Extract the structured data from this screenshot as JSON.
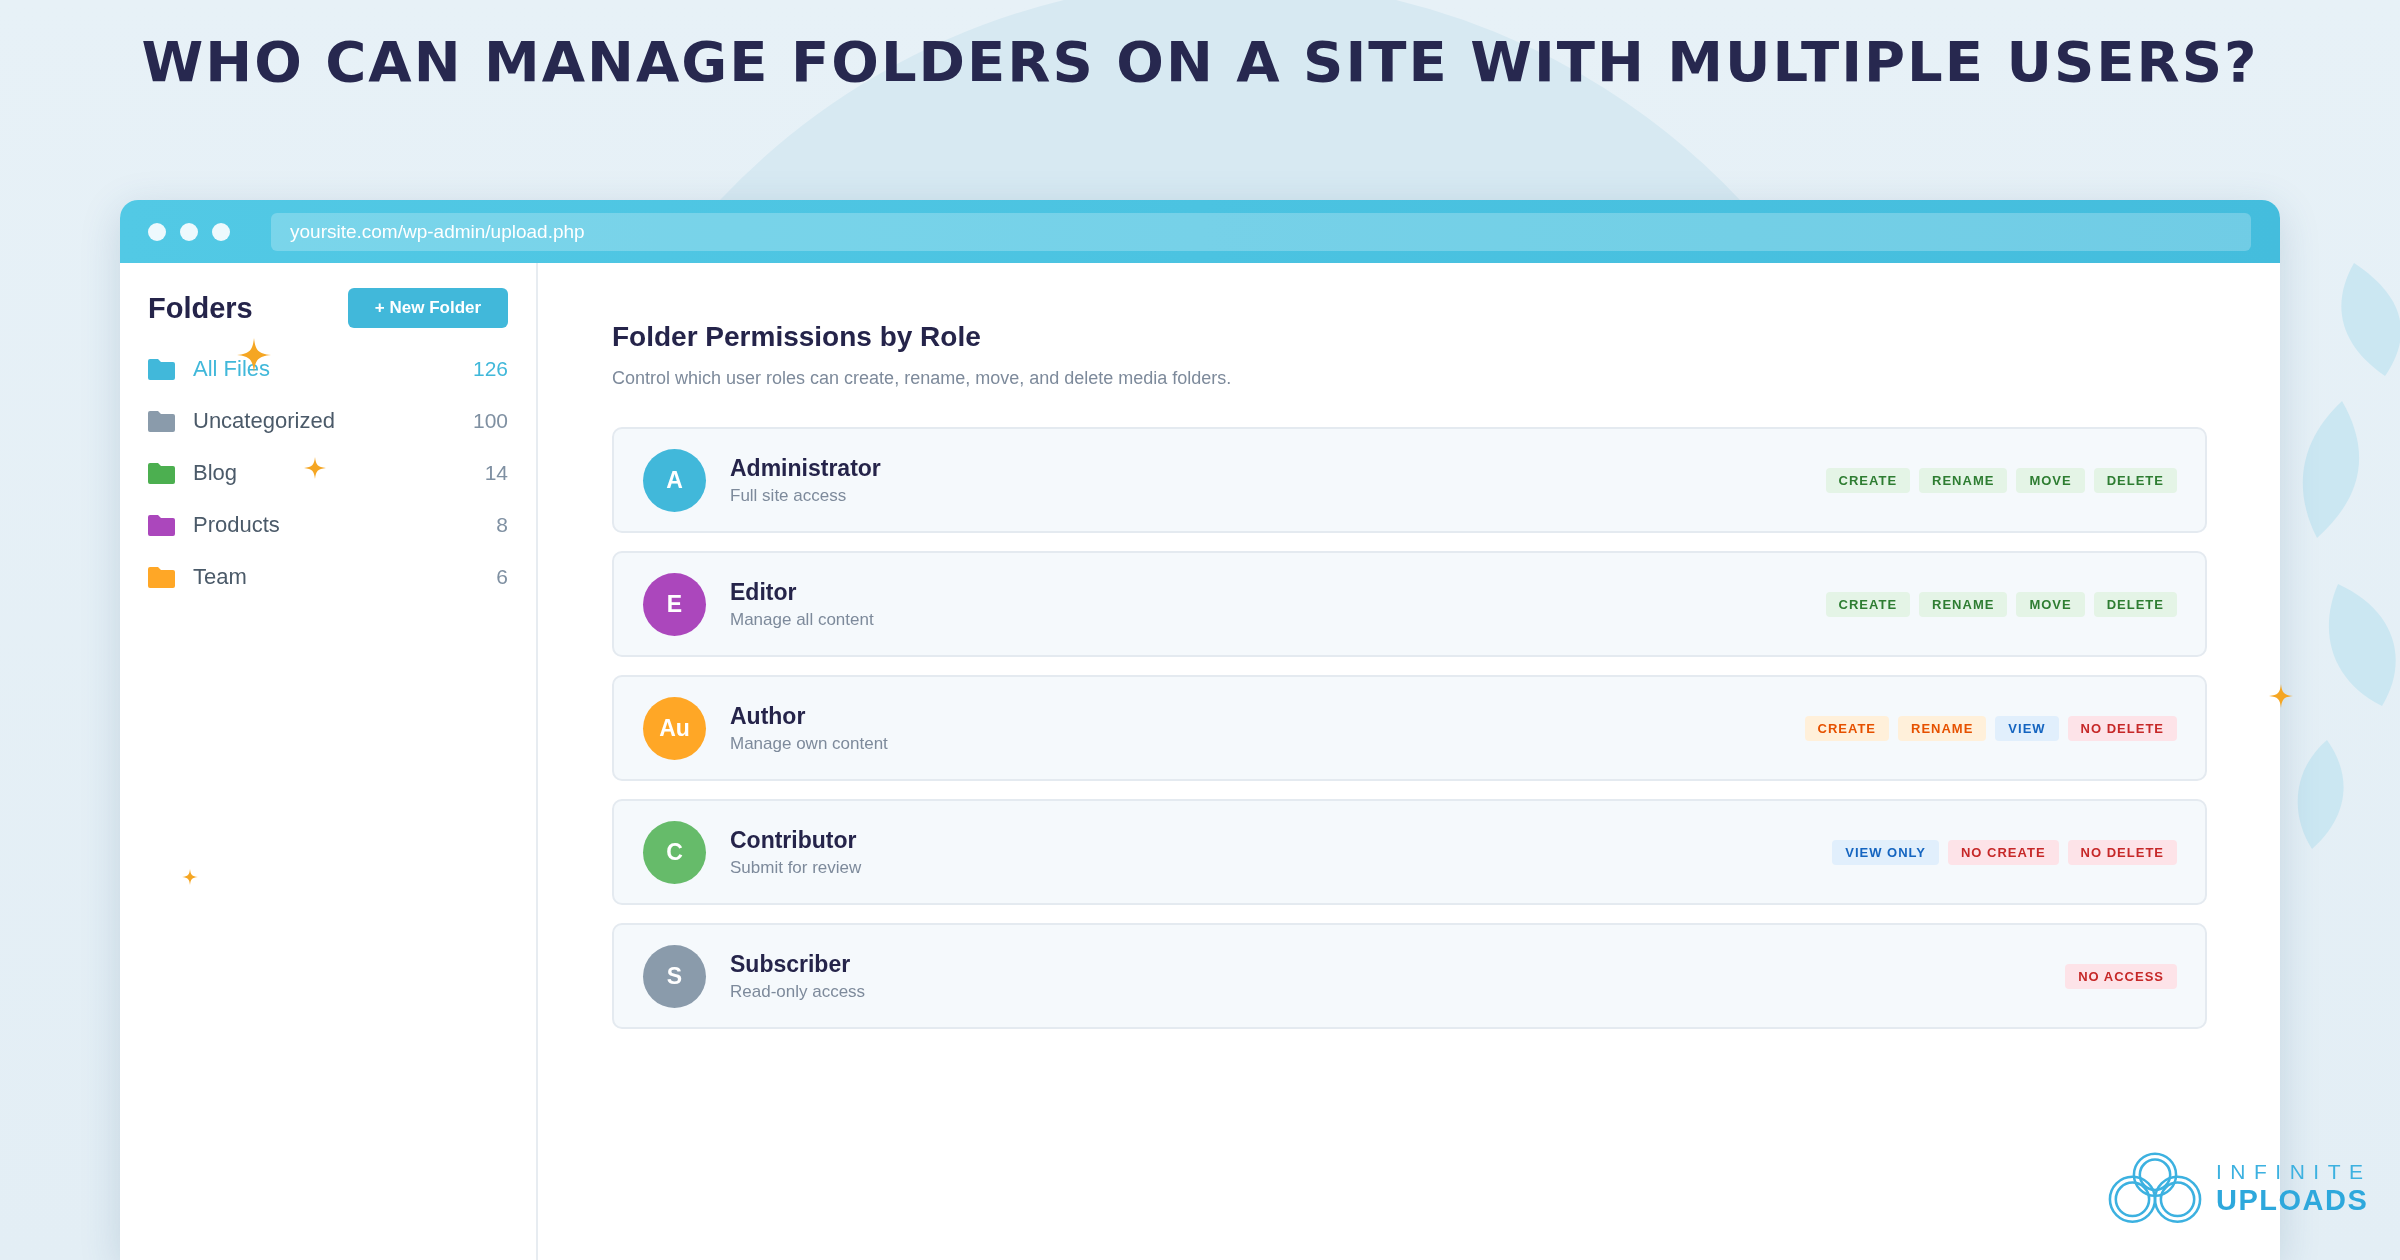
{
  "headline": "WHO CAN MANAGE FOLDERS ON A SITE WITH MULTIPLE USERS?",
  "browser": {
    "url": "yoursite.com/wp-admin/upload.php"
  },
  "sidebar": {
    "title": "Folders",
    "new_folder_button": "+ New Folder",
    "folders": [
      {
        "name": "All Files",
        "count": "126",
        "color": "#41b8da",
        "selected": true
      },
      {
        "name": "Uncategorized",
        "count": "100",
        "color": "#8a9bab",
        "selected": false
      },
      {
        "name": "Blog",
        "count": "14",
        "color": "#4caf50",
        "selected": false
      },
      {
        "name": "Products",
        "count": "8",
        "color": "#ab47bc",
        "selected": false
      },
      {
        "name": "Team",
        "count": "6",
        "color": "#ffa726",
        "selected": false
      }
    ]
  },
  "main": {
    "title": "Folder Permissions by Role",
    "subtitle": "Control which user roles can create, rename, move, and delete media folders.",
    "roles": [
      {
        "initials": "A",
        "color": "#41b8da",
        "name": "Administrator",
        "description": "Full site access",
        "permissions": [
          {
            "label": "CREATE",
            "kind": "granted"
          },
          {
            "label": "RENAME",
            "kind": "granted"
          },
          {
            "label": "MOVE",
            "kind": "granted"
          },
          {
            "label": "DELETE",
            "kind": "granted"
          }
        ]
      },
      {
        "initials": "E",
        "color": "#ab47bc",
        "name": "Editor",
        "description": "Manage all content",
        "permissions": [
          {
            "label": "CREATE",
            "kind": "granted"
          },
          {
            "label": "RENAME",
            "kind": "granted"
          },
          {
            "label": "MOVE",
            "kind": "granted"
          },
          {
            "label": "DELETE",
            "kind": "granted"
          }
        ]
      },
      {
        "initials": "Au",
        "color": "#ffa726",
        "name": "Author",
        "description": "Manage own content",
        "permissions": [
          {
            "label": "CREATE",
            "kind": "partial"
          },
          {
            "label": "RENAME",
            "kind": "partial"
          },
          {
            "label": "VIEW",
            "kind": "view"
          },
          {
            "label": "NO DELETE",
            "kind": "denied"
          }
        ]
      },
      {
        "initials": "C",
        "color": "#66bb6a",
        "name": "Contributor",
        "description": "Submit for review",
        "permissions": [
          {
            "label": "VIEW ONLY",
            "kind": "view"
          },
          {
            "label": "NO CREATE",
            "kind": "denied"
          },
          {
            "label": "NO DELETE",
            "kind": "denied"
          }
        ]
      },
      {
        "initials": "S",
        "color": "#8a9bab",
        "name": "Subscriber",
        "description": "Read-only access",
        "permissions": [
          {
            "label": "NO ACCESS",
            "kind": "denied"
          }
        ]
      }
    ]
  },
  "logo": {
    "line_1": "INFINITE",
    "line_2": "UPLOADS"
  }
}
